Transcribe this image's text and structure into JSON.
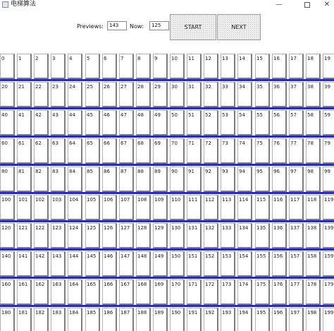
{
  "window": {
    "title": "电梯算法",
    "min_glyph": "—",
    "close_glyph": "✕",
    "bar_color": "#2b2fa6"
  },
  "controls": {
    "previews_label": "Previews:",
    "previews_value": "143",
    "now_label": "Now:",
    "now_value": "125",
    "start_label": "START",
    "next_label": "NEXT"
  },
  "floors": {
    "start": 0,
    "count": 200,
    "per_row": 20
  }
}
